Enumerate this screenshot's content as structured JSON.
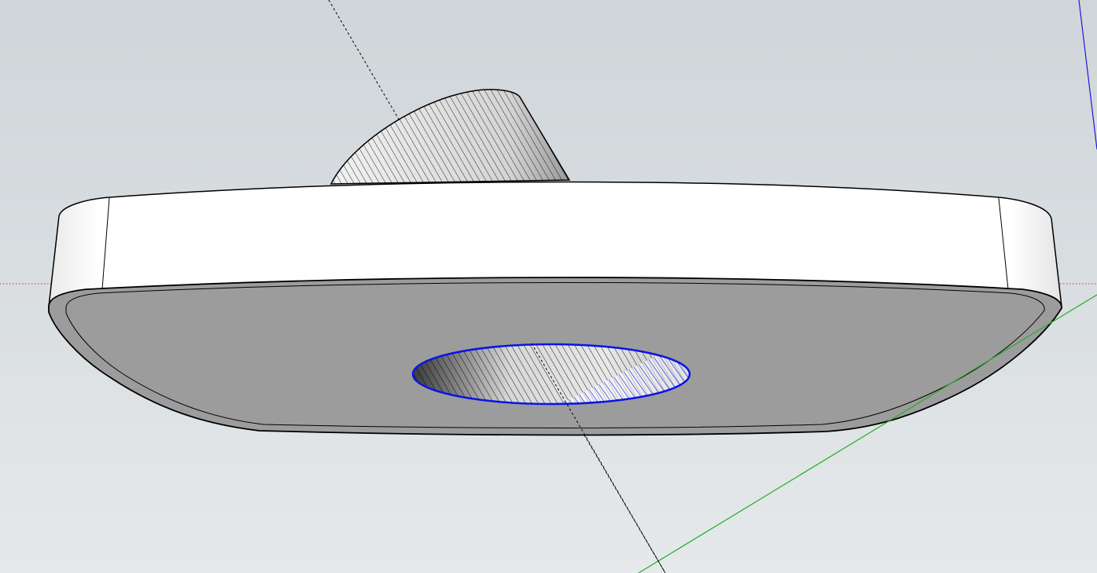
{
  "app": {
    "view": "3d-modeling-viewport",
    "visible_text": []
  },
  "colors": {
    "sky_top": "#d0d5d9",
    "ground_bottom": "#e6e9eb",
    "axis_red": "#d23232",
    "axis_green": "#22b022",
    "axis_blue": "#1a1ad8",
    "selection_blue": "#0a14e6",
    "face_white": "#ffffff",
    "face_gray": "#9c9c9c",
    "edge_black": "#000000"
  },
  "scene": {
    "axes": [
      "red-axis",
      "green-axis",
      "blue-axis"
    ],
    "guide": "dotted-guide-line",
    "model": {
      "parts": [
        "rounded-plate",
        "cylinder-boss",
        "selected-hole"
      ],
      "selected_part": "selected-hole"
    }
  }
}
